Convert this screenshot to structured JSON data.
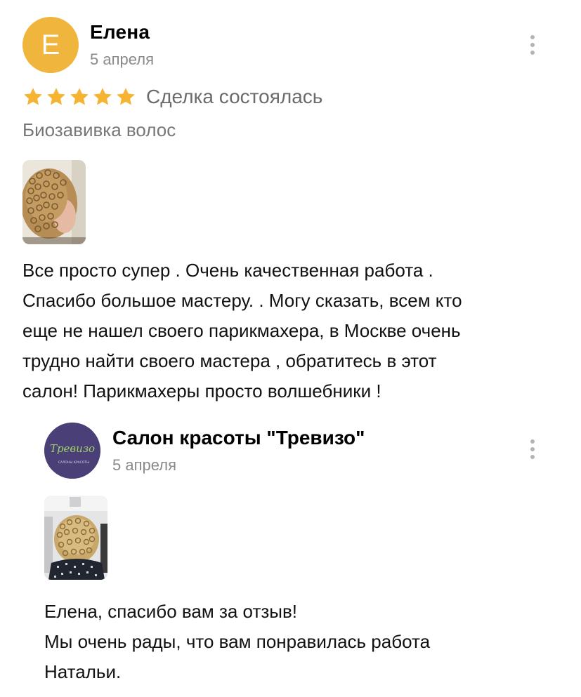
{
  "review": {
    "avatar_letter": "Е",
    "avatar_color": "#f0b53c",
    "author": "Елена",
    "date": "5 апреля",
    "rating": 5,
    "rating_max": 5,
    "star_color": "#f5b533",
    "deal_status": "Сделка состоялась",
    "service": "Биозавивка волос",
    "text": "Все просто супер . Очень качественная работа .\nСпасибо  большое мастеру. . Могу сказать, всем кто\nеще не нашел своего парикмахера, в  Москве очень\nтрудно найти своего мастера ,  обратитесь в этот\nсалон! Парикмахеры просто волшебники !",
    "menu_icon": "more-vertical-icon"
  },
  "reply": {
    "avatar_logo_text": "Тревизо",
    "avatar_logo_subtext": "САЛОНЫ КРАСОТЫ",
    "avatar_color": "#4a3f77",
    "author": "Салон красоты \"Тревизо\"",
    "date": "5 апреля",
    "text": "Елена, спасибо вам за отзыв!\nМы очень рады, что вам понравилась работа\nНатальи.",
    "menu_icon": "more-vertical-icon"
  }
}
